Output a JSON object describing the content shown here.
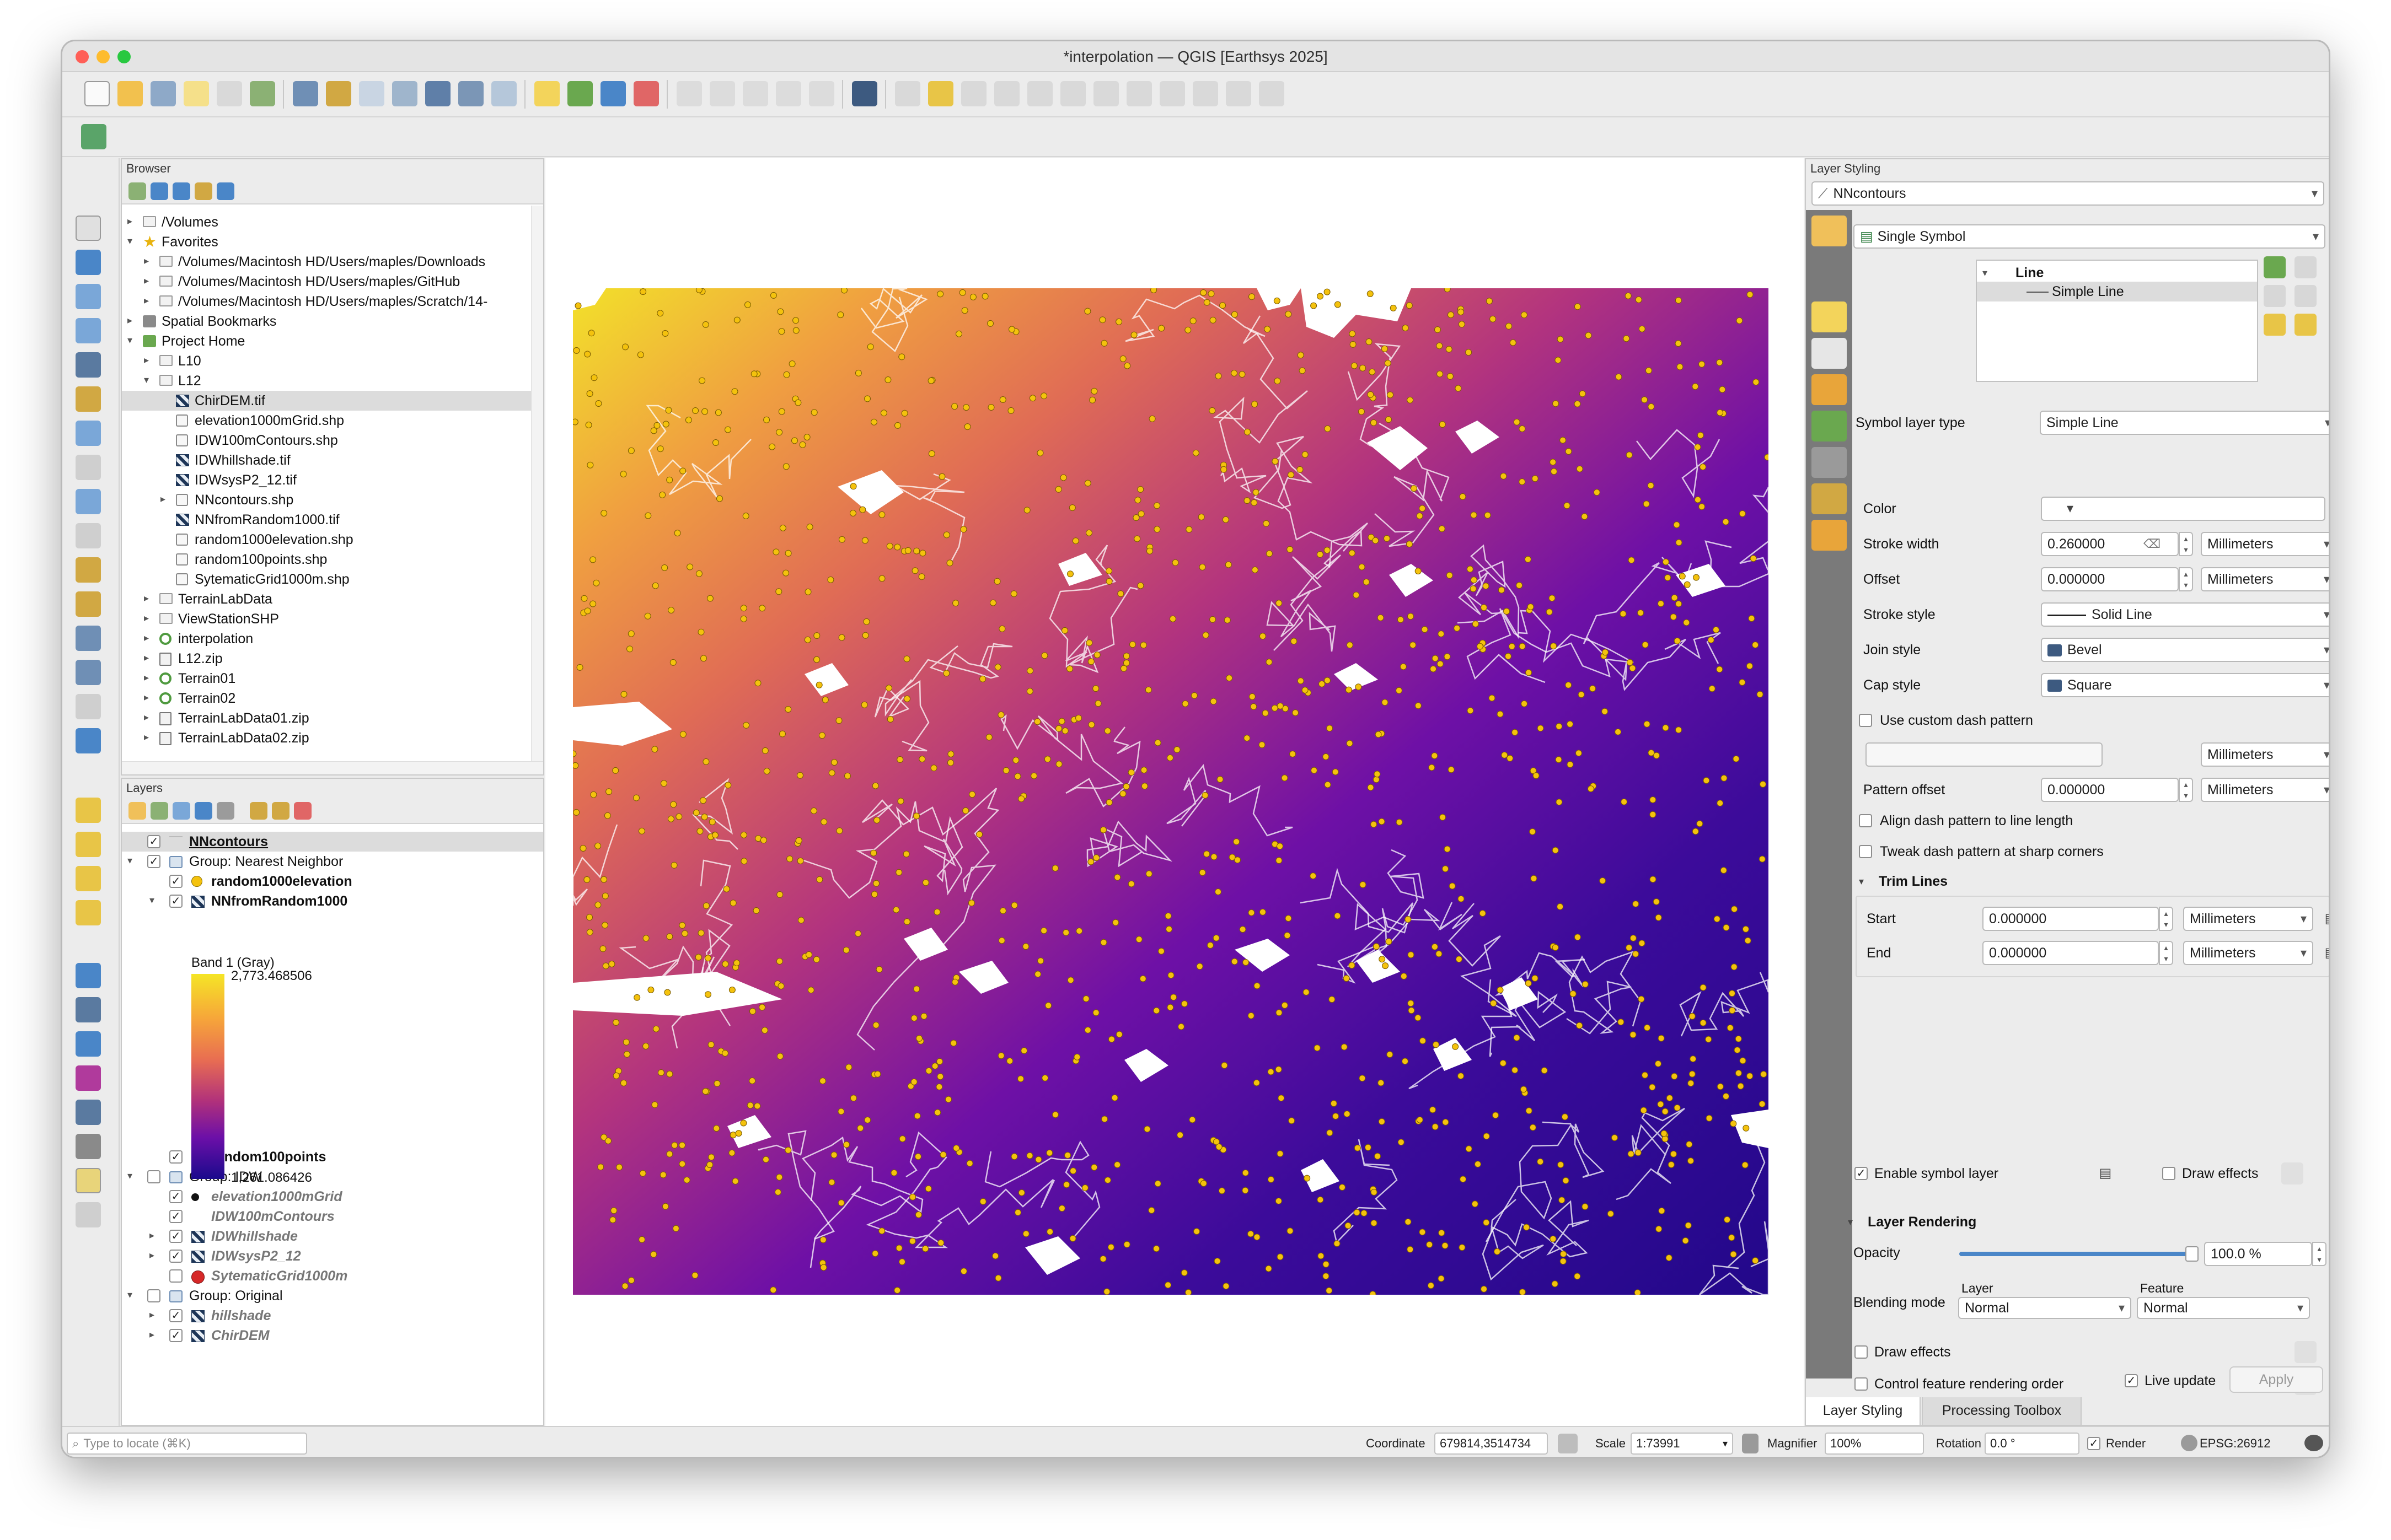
{
  "window": {
    "title": "*interpolation — QGIS [Earthsys 2025]"
  },
  "browser": {
    "title": "Browser",
    "items": [
      {
        "label": "/Volumes",
        "level": 0,
        "arrow": "▸",
        "icon": "folder"
      },
      {
        "label": "Favorites",
        "level": 0,
        "arrow": "▾",
        "icon": "star"
      },
      {
        "label": "/Volumes/Macintosh HD/Users/maples/Downloads",
        "level": 1,
        "arrow": "▸",
        "icon": "folder"
      },
      {
        "label": "/Volumes/Macintosh HD/Users/maples/GitHub",
        "level": 1,
        "arrow": "▸",
        "icon": "folder"
      },
      {
        "label": "/Volumes/Macintosh HD/Users/maples/Scratch/14-",
        "level": 1,
        "arrow": "▸",
        "icon": "folder"
      },
      {
        "label": "Spatial Bookmarks",
        "level": 0,
        "arrow": "▸",
        "icon": "bookmark"
      },
      {
        "label": "Project Home",
        "level": 0,
        "arrow": "▾",
        "icon": "home"
      },
      {
        "label": "L10",
        "level": 1,
        "arrow": "▸",
        "icon": "folder"
      },
      {
        "label": "L12",
        "level": 1,
        "arrow": "▾",
        "icon": "folder"
      },
      {
        "label": "ChirDEM.tif",
        "level": 2,
        "arrow": "",
        "icon": "raster",
        "selected": true
      },
      {
        "label": "elevation1000mGrid.shp",
        "level": 2,
        "arrow": "",
        "icon": "vector"
      },
      {
        "label": "IDW100mContours.shp",
        "level": 2,
        "arrow": "",
        "icon": "vector"
      },
      {
        "label": "IDWhillshade.tif",
        "level": 2,
        "arrow": "",
        "icon": "raster"
      },
      {
        "label": "IDWsysP2_12.tif",
        "level": 2,
        "arrow": "",
        "icon": "raster"
      },
      {
        "label": "NNcontours.shp",
        "level": 2,
        "arrow": "▸",
        "icon": "vector"
      },
      {
        "label": "NNfromRandom1000.tif",
        "level": 2,
        "arrow": "",
        "icon": "raster"
      },
      {
        "label": "random1000elevation.shp",
        "level": 2,
        "arrow": "",
        "icon": "vector"
      },
      {
        "label": "random100points.shp",
        "level": 2,
        "arrow": "",
        "icon": "vector"
      },
      {
        "label": "SytematicGrid1000m.shp",
        "level": 2,
        "arrow": "",
        "icon": "vector"
      },
      {
        "label": "TerrainLabData",
        "level": 1,
        "arrow": "▸",
        "icon": "folder"
      },
      {
        "label": "ViewStationSHP",
        "level": 1,
        "arrow": "▸",
        "icon": "folder"
      },
      {
        "label": "interpolation",
        "level": 1,
        "arrow": "▸",
        "icon": "qgis"
      },
      {
        "label": "L12.zip",
        "level": 1,
        "arrow": "▸",
        "icon": "zip"
      },
      {
        "label": "Terrain01",
        "level": 1,
        "arrow": "▸",
        "icon": "qgis"
      },
      {
        "label": "Terrain02",
        "level": 1,
        "arrow": "▸",
        "icon": "qgis"
      },
      {
        "label": "TerrainLabData01.zip",
        "level": 1,
        "arrow": "▸",
        "icon": "zip"
      },
      {
        "label": "TerrainLabData02.zip",
        "level": 1,
        "arrow": "▸",
        "icon": "zip"
      }
    ]
  },
  "layers": {
    "title": "Layers",
    "items": [
      {
        "label": "NNcontours",
        "level": 0,
        "arrow": "",
        "checked": true,
        "style": "bold-underline",
        "icon": "line",
        "selected": true
      },
      {
        "label": "Group: Nearest Neighbor",
        "level": 0,
        "arrow": "▾",
        "checked": true,
        "style": "normal",
        "icon": "group"
      },
      {
        "label": "random1000elevation",
        "level": 1,
        "arrow": "",
        "checked": true,
        "style": "bold",
        "icon": "yellow-dot"
      },
      {
        "label": "NNfromRandom1000",
        "level": 1,
        "arrow": "▾",
        "checked": true,
        "style": "bold",
        "icon": "raster"
      },
      {
        "label": "random100points",
        "level": 1,
        "arrow": "",
        "checked": true,
        "style": "bold",
        "icon": "green-dot"
      },
      {
        "label": "Group: IDW",
        "level": 0,
        "arrow": "▾",
        "checked": false,
        "style": "normal",
        "icon": "group"
      },
      {
        "label": "elevation1000mGrid",
        "level": 1,
        "arrow": "",
        "checked": true,
        "style": "italic-grey",
        "icon": "black-dot"
      },
      {
        "label": "IDW100mContours",
        "level": 1,
        "arrow": "",
        "checked": true,
        "style": "italic-grey",
        "icon": "none"
      },
      {
        "label": "IDWhillshade",
        "level": 1,
        "arrow": "▸",
        "checked": true,
        "style": "italic-grey",
        "icon": "raster"
      },
      {
        "label": "IDWsysP2_12",
        "level": 1,
        "arrow": "▸",
        "checked": true,
        "style": "italic-grey",
        "icon": "raster"
      },
      {
        "label": "SytematicGrid1000m",
        "level": 1,
        "arrow": "",
        "checked": false,
        "style": "italic-grey",
        "icon": "red-dot"
      },
      {
        "label": "Group: Original",
        "level": 0,
        "arrow": "▾",
        "checked": false,
        "style": "normal",
        "icon": "group"
      },
      {
        "label": "hillshade",
        "level": 1,
        "arrow": "▸",
        "checked": true,
        "style": "italic-grey",
        "icon": "raster"
      },
      {
        "label": "ChirDEM",
        "level": 1,
        "arrow": "▸",
        "checked": true,
        "style": "italic-grey",
        "icon": "raster"
      }
    ],
    "band_label": "Band 1 (Gray)",
    "legend_max": "2,773.468506",
    "legend_min": "1,261.086426"
  },
  "styling": {
    "title": "Layer Styling",
    "layer": "NNcontours",
    "renderer": "Single Symbol",
    "tree_root": "Line",
    "tree_child": "Simple Line",
    "symbol_layer_type_label": "Symbol layer type",
    "symbol_layer_type": "Simple Line",
    "color_label": "Color",
    "color_value": "#ffffff",
    "stroke_width_label": "Stroke width",
    "stroke_width": "0.260000",
    "offset_label": "Offset",
    "offset": "0.000000",
    "stroke_style_label": "Stroke style",
    "stroke_style": "Solid Line",
    "join_style_label": "Join style",
    "join_style": "Bevel",
    "cap_style_label": "Cap style",
    "cap_style": "Square",
    "use_dash_label": "Use custom dash pattern",
    "pattern_offset_label": "Pattern offset",
    "pattern_offset": "0.000000",
    "align_dash_label": "Align dash pattern to line length",
    "tweak_dash_label": "Tweak dash pattern at sharp corners",
    "trim_lines_label": "Trim Lines",
    "start_label": "Start",
    "start": "0.000000",
    "end_label": "End",
    "end": "0.000000",
    "unit": "Millimeters",
    "enable_symbol_layer_label": "Enable symbol layer",
    "draw_effects_label": "Draw effects",
    "layer_rendering_label": "Layer Rendering",
    "opacity_label": "Opacity",
    "opacity": "100.0 %",
    "opacity_value": 1.0,
    "blending_label": "Blending mode",
    "blend_layer_label": "Layer",
    "blend_feature_label": "Feature",
    "blend_layer": "Normal",
    "blend_feature": "Normal",
    "draw_effects2_label": "Draw effects",
    "control_order_label": "Control feature rendering order",
    "live_update_label": "Live update",
    "apply_label": "Apply",
    "tab_styling": "Layer Styling",
    "tab_processing": "Processing Toolbox"
  },
  "statusbar": {
    "locate_placeholder": "Type to locate (⌘K)",
    "coordinate_label": "Coordinate",
    "coordinate": "679814,3514734",
    "scale_label": "Scale",
    "scale": "1:73991",
    "magnifier_label": "Magnifier",
    "magnifier": "100%",
    "rotation_label": "Rotation",
    "rotation": "0.0 °",
    "render_label": "Render",
    "crs": "EPSG:26912"
  },
  "colors": {
    "ramp_top": "#f5e526",
    "ramp_mid": "#e86d52",
    "ramp_low": "#6b0fa8",
    "ramp_bottom": "#1a0a8c",
    "points": "#f4c20d"
  }
}
